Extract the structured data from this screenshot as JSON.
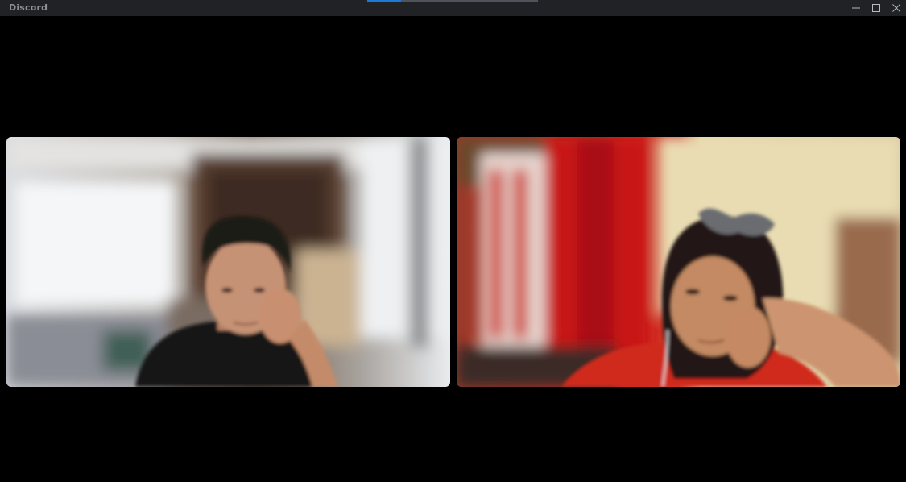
{
  "window": {
    "title": "Discord",
    "controls": [
      "minimize-icon",
      "maximize-icon",
      "close-icon"
    ]
  },
  "update_progress": {
    "fraction": 0.2
  },
  "call": {
    "tiles": [
      {
        "icon": "participant-video-feed"
      },
      {
        "icon": "participant-video-feed"
      }
    ]
  },
  "colors": {
    "titlebar": "#202225",
    "title_text": "#8e9297",
    "progress_fill": "#1e78d7",
    "stage_background": "#000000"
  }
}
